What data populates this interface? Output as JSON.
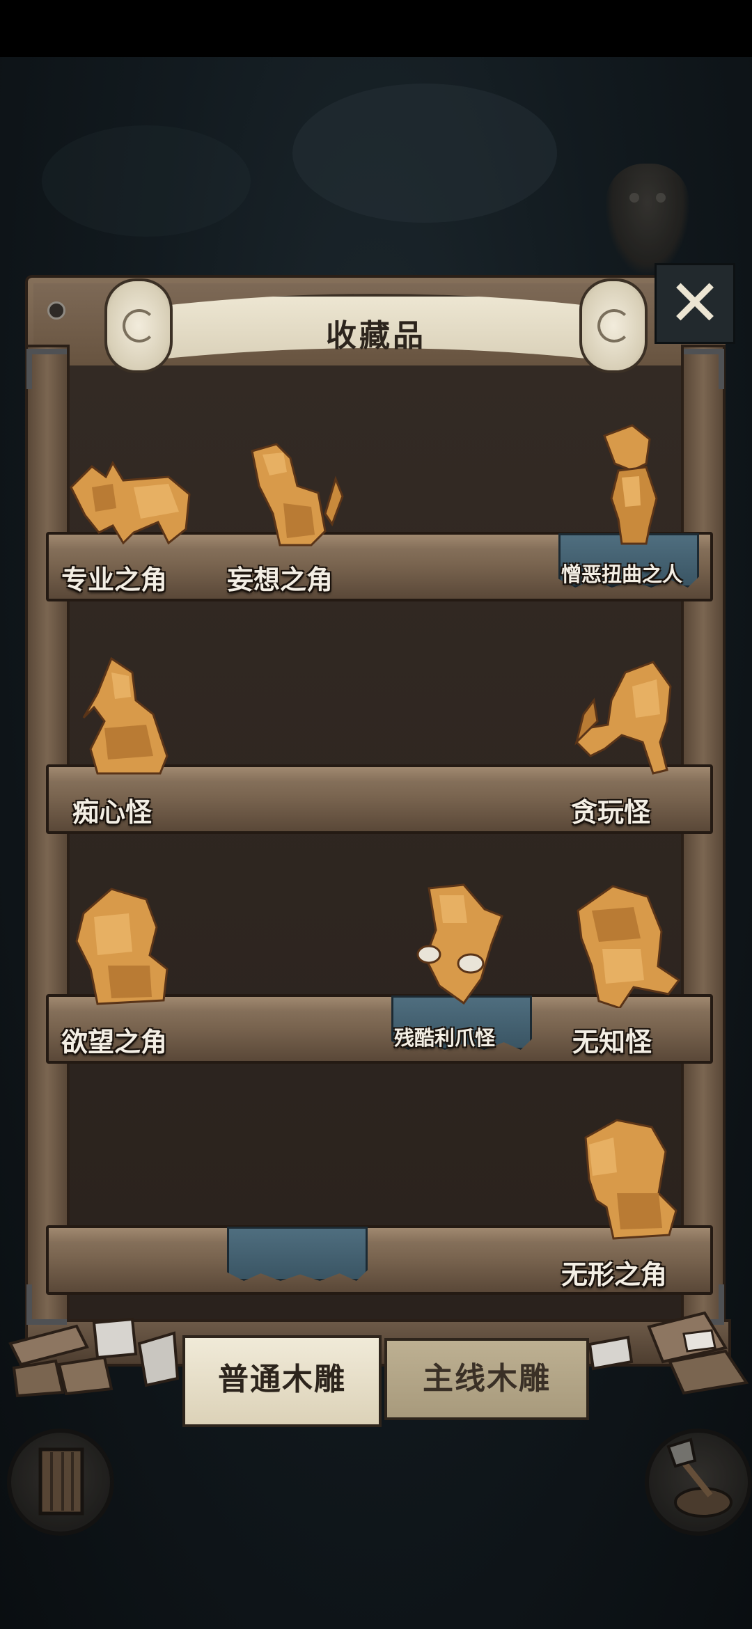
{
  "panel": {
    "title": "收藏品",
    "close_icon": "close-icon"
  },
  "shelves": [
    {
      "items": [
        {
          "name": "专业之角",
          "icon": "wooden-ox-figurine-icon",
          "highlighted": false
        },
        {
          "name": "妄想之角",
          "icon": "wooden-tiger-figurine-icon",
          "highlighted": false
        },
        {
          "name": "憎恶扭曲之人",
          "icon": "wooden-man-figurine-icon",
          "highlighted": true
        }
      ]
    },
    {
      "items": [
        {
          "name": "痴心怪",
          "icon": "wooden-bird-monster-figurine-icon",
          "highlighted": false
        },
        {
          "name": "贪玩怪",
          "icon": "wooden-mantis-monster-figurine-icon",
          "highlighted": false
        }
      ]
    },
    {
      "items": [
        {
          "name": "欲望之角",
          "icon": "wooden-lion-figurine-icon",
          "highlighted": false
        },
        {
          "name": "残酷利爪怪",
          "icon": "wooden-claw-monster-figurine-icon",
          "highlighted": true
        },
        {
          "name": "无知怪",
          "icon": "wooden-hooded-monster-figurine-icon",
          "highlighted": false
        }
      ]
    },
    {
      "items": [
        {
          "name": "",
          "icon": "empty-pedestal",
          "highlighted": true
        },
        {
          "name": "无形之角",
          "icon": "wooden-elephant-figurine-icon",
          "highlighted": false
        }
      ]
    }
  ],
  "tabs": [
    {
      "label": "普通木雕",
      "active": true
    },
    {
      "label": "主线木雕",
      "active": false
    }
  ],
  "corner_buttons": {
    "left_icon": "door-icon",
    "right_icon": "axe-on-stump-icon"
  },
  "colors": {
    "wood": "#7a6550",
    "highlight_pedestal": "#4f6e7f",
    "figurine": "#d89a4a",
    "parchment": "#ede6d2"
  }
}
